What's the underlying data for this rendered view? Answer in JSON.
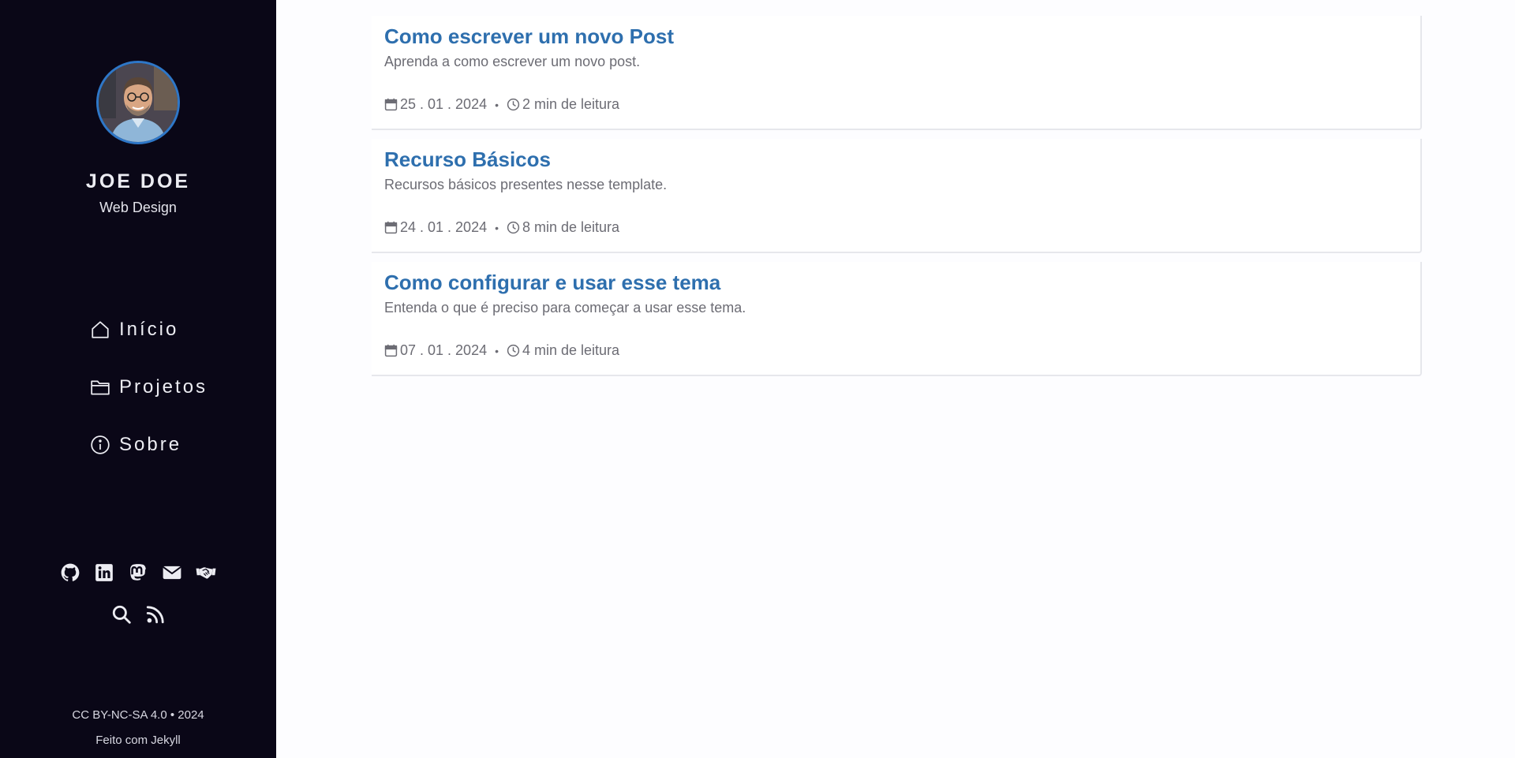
{
  "profile": {
    "name": "JOE DOE",
    "role": "Web Design"
  },
  "nav": {
    "items": [
      {
        "label": "Início",
        "icon": "home-icon"
      },
      {
        "label": "Projetos",
        "icon": "folder-icon"
      },
      {
        "label": "Sobre",
        "icon": "info-icon"
      }
    ]
  },
  "social": {
    "icons": [
      "github-icon",
      "linkedin-icon",
      "mastodon-icon",
      "email-icon",
      "handshake-icon",
      "search-icon",
      "rss-icon"
    ]
  },
  "footer": {
    "license": "CC BY-NC-SA 4.0 • 2024",
    "built_with": "Feito com Jekyll"
  },
  "posts": [
    {
      "title": "Como escrever um novo Post",
      "description": "Aprenda a como escrever um novo post.",
      "date": "25 . 01 . 2024",
      "separator": "•",
      "reading_time": "2 min de leitura"
    },
    {
      "title": "Recurso Básicos",
      "description": "Recursos básicos presentes nesse template.",
      "date": "24 . 01 . 2024",
      "separator": "•",
      "reading_time": "8 min de leitura"
    },
    {
      "title": "Como configurar e usar esse tema",
      "description": "Entenda o que é preciso para começar a usar esse tema.",
      "date": "07 . 01 . 2024",
      "separator": "•",
      "reading_time": "4 min de leitura"
    }
  ],
  "colors": {
    "sidebar_bg": "#0a0717",
    "accent": "#2e6fae",
    "avatar_ring": "#2e77c8",
    "muted_text": "#6c6c74"
  }
}
